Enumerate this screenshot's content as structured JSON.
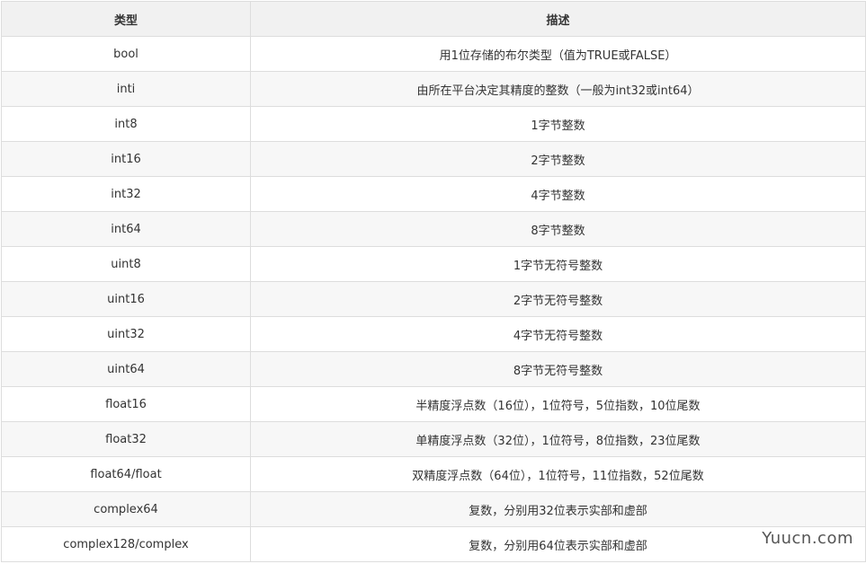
{
  "table": {
    "headers": [
      "类型",
      "描述"
    ],
    "rows": [
      {
        "type": "bool",
        "desc": "用1位存储的布尔类型（值为TRUE或FALSE）"
      },
      {
        "type": "inti",
        "desc": "由所在平台决定其精度的整数（一般为int32或int64）"
      },
      {
        "type": "int8",
        "desc": "1字节整数"
      },
      {
        "type": "int16",
        "desc": "2字节整数"
      },
      {
        "type": "int32",
        "desc": "4字节整数"
      },
      {
        "type": "int64",
        "desc": "8字节整数"
      },
      {
        "type": "uint8",
        "desc": "1字节无符号整数"
      },
      {
        "type": "uint16",
        "desc": "2字节无符号整数"
      },
      {
        "type": "uint32",
        "desc": "4字节无符号整数"
      },
      {
        "type": "uint64",
        "desc": "8字节无符号整数"
      },
      {
        "type": "float16",
        "desc": "半精度浮点数（16位），1位符号，5位指数，10位尾数"
      },
      {
        "type": "float32",
        "desc": "单精度浮点数（32位），1位符号，8位指数，23位尾数"
      },
      {
        "type": "float64/float",
        "desc": "双精度浮点数（64位），1位符号，11位指数，52位尾数"
      },
      {
        "type": "complex64",
        "desc": "复数，分别用32位表示实部和虚部"
      },
      {
        "type": "complex128/complex",
        "desc": "复数，分别用64位表示实部和虚部"
      }
    ]
  },
  "watermark": "Yuucn.com"
}
